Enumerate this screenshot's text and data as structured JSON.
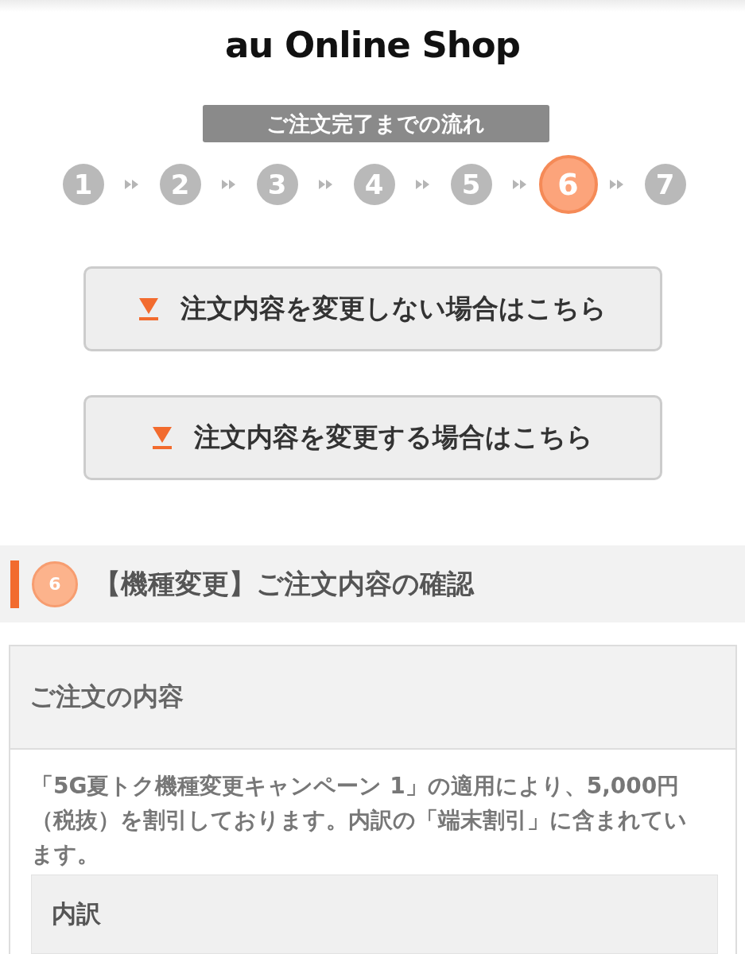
{
  "header": {
    "logo": "au Online Shop"
  },
  "flow": {
    "title": "ご注文完了までの流れ",
    "steps": [
      {
        "label": "1",
        "selected": false
      },
      {
        "label": "2",
        "selected": false
      },
      {
        "label": "3",
        "selected": false
      },
      {
        "label": "4",
        "selected": false
      },
      {
        "label": "5",
        "selected": false
      },
      {
        "label": "6",
        "selected": true
      },
      {
        "label": "7",
        "selected": false
      }
    ]
  },
  "buttons": [
    {
      "label": "注文内容を変更しない場合はこちら"
    },
    {
      "label": "注文内容を変更する場合はこちら"
    }
  ],
  "section": {
    "step": "6",
    "title": "【機種変更】ご注文内容の確認"
  },
  "order_card": {
    "title": "ご注文の内容",
    "note": "「5G夏トク機種変更キャンペーン 1」の適用により、5,000円（税抜）を割引しております。内訳の「端末割引」に含まれています。",
    "breakdown": {
      "title": "内訳"
    }
  }
}
